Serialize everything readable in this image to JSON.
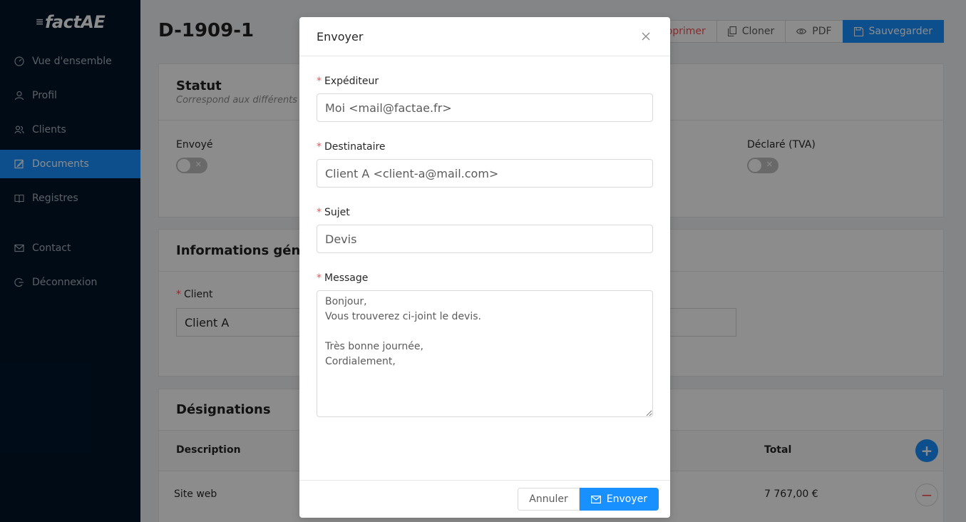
{
  "app": {
    "logo": "factAE"
  },
  "sidebar": {
    "items": [
      {
        "label": "Vue d'ensemble",
        "icon": "dashboard-icon"
      },
      {
        "label": "Profil",
        "icon": "user-icon"
      },
      {
        "label": "Clients",
        "icon": "team-icon"
      },
      {
        "label": "Documents",
        "icon": "edit-icon",
        "active": true
      },
      {
        "label": "Registres",
        "icon": "book-icon"
      },
      {
        "label": "Contact",
        "icon": "mail-icon"
      },
      {
        "label": "Déconnexion",
        "icon": "logout-icon"
      }
    ]
  },
  "page": {
    "title": "D-1909-1",
    "toolbar": {
      "delete": "Supprimer",
      "clone": "Cloner",
      "pdf": "PDF",
      "save": "Sauvegarder"
    }
  },
  "status_card": {
    "title": "Statut",
    "subtitle": "Correspond aux différents s",
    "sent_label": "Envoyé",
    "declared_label": "Déclaré (TVA)",
    "toggle_off": "✕"
  },
  "info_card": {
    "title": "Informations généra",
    "client_label": "Client",
    "client_value": "Client A"
  },
  "designations": {
    "title": "Désignations",
    "col_description": "Description",
    "col_total": "Total",
    "rows": [
      {
        "description": "Site web",
        "total": "7 767,00 €"
      }
    ]
  },
  "modal": {
    "title": "Envoyer",
    "sender_label": "Expéditeur",
    "sender_value": "Moi <mail@factae.fr>",
    "recipient_label": "Destinataire",
    "recipient_value": "Client A <client-a@mail.com>",
    "subject_label": "Sujet",
    "subject_value": "Devis",
    "message_label": "Message",
    "message_value": "Bonjour,\nVous trouverez ci-joint le devis.\n\nTrès bonne journée,\nCordialement,",
    "cancel": "Annuler",
    "send": "Envoyer",
    "required_mark": "*"
  },
  "colors": {
    "primary": "#1890ff",
    "sidebar": "#001529",
    "danger": "#ff4d4f"
  }
}
